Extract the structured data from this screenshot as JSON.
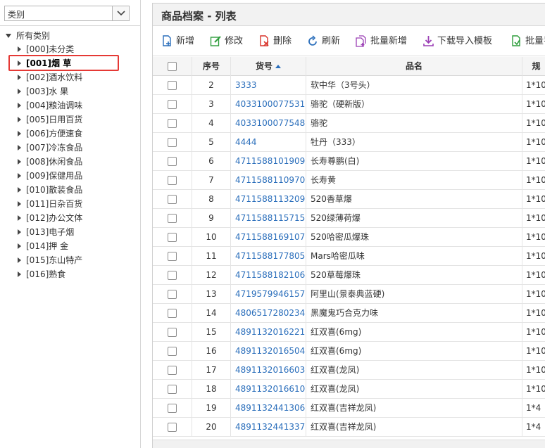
{
  "category_select": {
    "value": "类别"
  },
  "tree": {
    "root_label": "所有类别",
    "items": [
      {
        "label": "[000]未分类",
        "selected": false
      },
      {
        "label": "[001]烟 草",
        "selected": true
      },
      {
        "label": "[002]酒水饮料",
        "selected": false
      },
      {
        "label": "[003]水 果",
        "selected": false
      },
      {
        "label": "[004]粮油调味",
        "selected": false
      },
      {
        "label": "[005]日用百货",
        "selected": false
      },
      {
        "label": "[006]方便速食",
        "selected": false
      },
      {
        "label": "[007]冷冻食品",
        "selected": false
      },
      {
        "label": "[008]休闲食品",
        "selected": false
      },
      {
        "label": "[009]保健用品",
        "selected": false
      },
      {
        "label": "[010]散装食品",
        "selected": false
      },
      {
        "label": "[011]日杂百货",
        "selected": false
      },
      {
        "label": "[012]办公文体",
        "selected": false
      },
      {
        "label": "[013]电子烟",
        "selected": false
      },
      {
        "label": "[014]押 金",
        "selected": false
      },
      {
        "label": "[015]东山特产",
        "selected": false
      },
      {
        "label": "[016]熟食",
        "selected": false
      }
    ]
  },
  "panel": {
    "title": "商品档案 - 列表"
  },
  "toolbar": {
    "add": "新增",
    "edit": "修改",
    "delete": "删除",
    "refresh": "刷新",
    "batch_add": "批量新增",
    "download_template": "下载导入模板",
    "batch_import": "批量导"
  },
  "colors": {
    "add_icon": "#2a6ebb",
    "edit_icon": "#2e9d3c",
    "delete_icon": "#d9342b",
    "refresh_icon": "#2a6ebb",
    "batch_add_icon": "#9b3fb5",
    "download_icon": "#9b3fb5",
    "batch_import_icon": "#2e9d3c",
    "link": "#2a6ebb",
    "highlight": "#e53935"
  },
  "grid": {
    "headers": {
      "seq": "序号",
      "code": "货号",
      "name": "品名",
      "spec": "规"
    },
    "rows": [
      {
        "seq": "2",
        "code": "3333",
        "name": "软中华（3号头）",
        "spec": "1*10"
      },
      {
        "seq": "3",
        "code": "4033100077531",
        "name": "骆驼（硬新版）",
        "spec": "1*10"
      },
      {
        "seq": "4",
        "code": "4033100077548",
        "name": "骆驼",
        "spec": "1*10"
      },
      {
        "seq": "5",
        "code": "4444",
        "name": "牡丹（333）",
        "spec": "1*10"
      },
      {
        "seq": "6",
        "code": "4711588101909",
        "name": "长寿尊鹏(白)",
        "spec": "1*10"
      },
      {
        "seq": "7",
        "code": "4711588110970",
        "name": "长寿黄",
        "spec": "1*10"
      },
      {
        "seq": "8",
        "code": "4711588113209",
        "name": "520香草爆",
        "spec": "1*10"
      },
      {
        "seq": "9",
        "code": "4711588115715",
        "name": "520绿薄荷爆",
        "spec": "1*10"
      },
      {
        "seq": "10",
        "code": "4711588169107",
        "name": "520哈密瓜爆珠",
        "spec": "1*10"
      },
      {
        "seq": "11",
        "code": "4711588177805",
        "name": "Mars哈密瓜味",
        "spec": "1*10"
      },
      {
        "seq": "12",
        "code": "4711588182106",
        "name": "520草莓爆珠",
        "spec": "1*10"
      },
      {
        "seq": "13",
        "code": "4719579946157",
        "name": "阿里山(景泰典蓝硬)",
        "spec": "1*10"
      },
      {
        "seq": "14",
        "code": "4806517280234",
        "name": "黑魔鬼巧合克力味",
        "spec": "1*10"
      },
      {
        "seq": "15",
        "code": "4891132016221",
        "name": "红双喜(6mg)",
        "spec": "1*10"
      },
      {
        "seq": "16",
        "code": "4891132016504",
        "name": "红双喜(6mg)",
        "spec": "1*10"
      },
      {
        "seq": "17",
        "code": "4891132016603",
        "name": "红双喜(龙凤)",
        "spec": "1*10"
      },
      {
        "seq": "18",
        "code": "4891132016610",
        "name": "红双喜(龙凤)",
        "spec": "1*10"
      },
      {
        "seq": "19",
        "code": "4891132441306",
        "name": "红双喜(吉祥龙凤)",
        "spec": "1*4"
      },
      {
        "seq": "20",
        "code": "4891132441337",
        "name": "红双喜(吉祥龙凤)",
        "spec": "1*4"
      }
    ]
  }
}
